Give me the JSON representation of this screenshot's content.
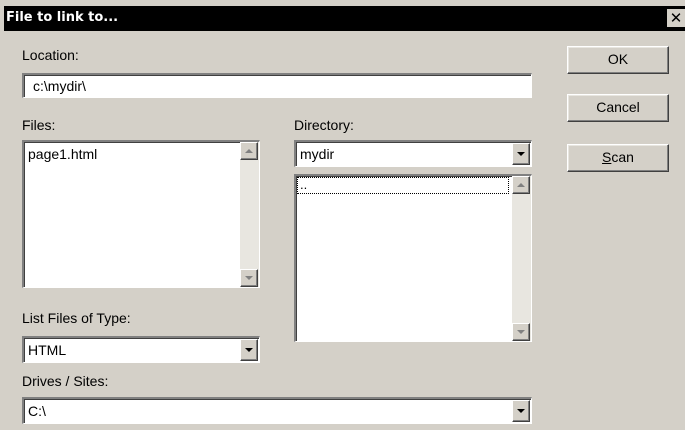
{
  "dialog": {
    "title": "File to link to...",
    "close_glyph": "✕"
  },
  "location": {
    "label": "Location:",
    "value": "c:\\mydir\\"
  },
  "files": {
    "label": "Files:",
    "items": [
      "page1.html"
    ]
  },
  "directory": {
    "label": "Directory:",
    "selected": "mydir",
    "items": [
      ".."
    ]
  },
  "file_type": {
    "label": "List Files of Type:",
    "selected": "HTML"
  },
  "drives": {
    "label": "Drives / Sites:",
    "selected": "C:\\"
  },
  "buttons": {
    "ok": "OK",
    "cancel": "Cancel",
    "scan_mnemonic": "S",
    "scan_rest": "can"
  },
  "icons": {
    "scroll_up": "triangle-up-icon",
    "scroll_down": "triangle-down-icon",
    "dropdown": "triangle-down-icon"
  },
  "colors": {
    "face": "#d4d0c8",
    "titlebar": "#000000",
    "field": "#ffffff"
  }
}
